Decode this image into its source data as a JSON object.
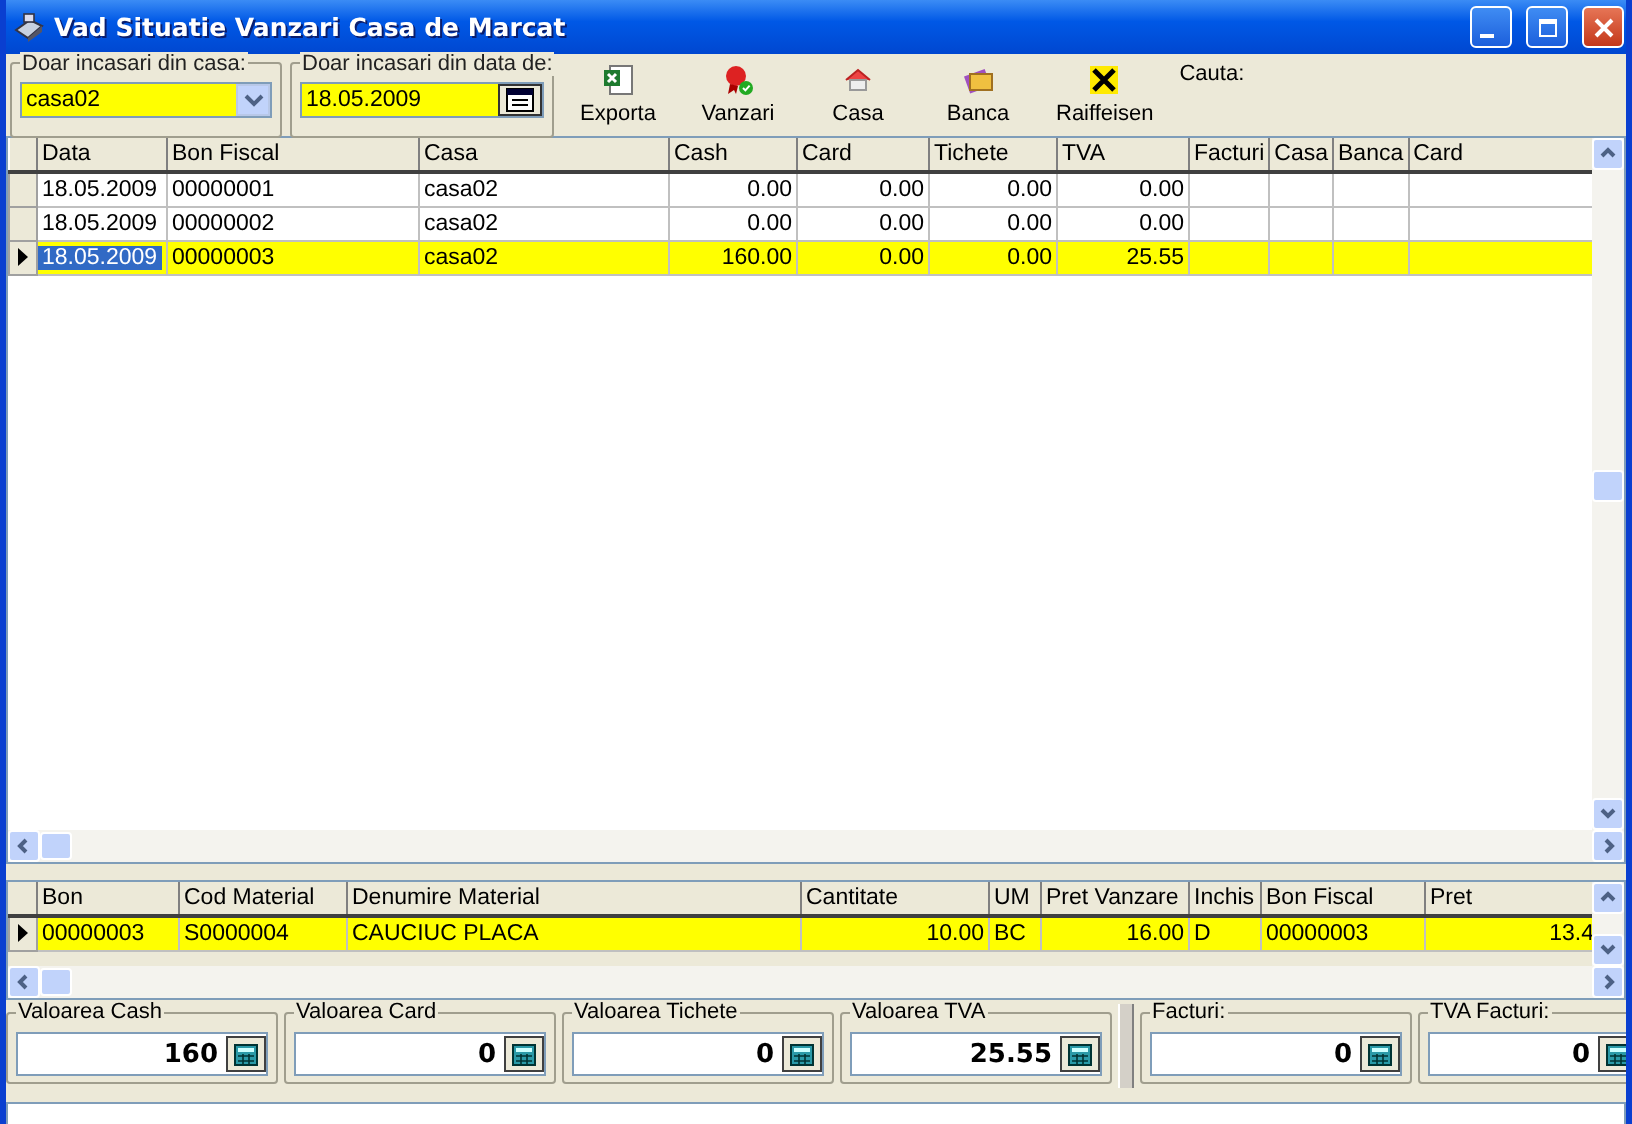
{
  "window": {
    "title": "Vad Situatie Vanzari Casa de Marcat"
  },
  "filters": [
    {
      "kind": "combo",
      "label": "Doar incasari din casa:",
      "value": "casa02"
    },
    {
      "kind": "date",
      "label": "Doar incasari din data de:",
      "value": "18.05.2009"
    }
  ],
  "toolbar": [
    {
      "kind": "spreadsheet",
      "label": "Exporta"
    },
    {
      "kind": "ribbon",
      "label": "Vanzari"
    },
    {
      "kind": "house",
      "label": "Casa"
    },
    {
      "kind": "bank",
      "label": "Banca"
    },
    {
      "kind": "cross",
      "label": "Raiffeisen"
    }
  ],
  "search": {
    "label": "Cauta:"
  },
  "main_table": {
    "columns": [
      {
        "label": "Data",
        "kind": "text"
      },
      {
        "label": "Bon Fiscal",
        "kind": "text"
      },
      {
        "label": "Casa",
        "kind": "text"
      },
      {
        "label": "Cash",
        "kind": "number"
      },
      {
        "label": "Card",
        "kind": "number"
      },
      {
        "label": "Tichete",
        "kind": "number"
      },
      {
        "label": "TVA",
        "kind": "number"
      },
      {
        "label": "Facturi",
        "kind": "text"
      },
      {
        "label": "Casa",
        "kind": "text"
      },
      {
        "label": "Banca",
        "kind": "text"
      },
      {
        "label": "Card",
        "kind": "text"
      }
    ],
    "rows": [
      {
        "selected": false,
        "cells": [
          "18.05.2009",
          "00000001",
          "casa02",
          "0.00",
          "0.00",
          "0.00",
          "0.00",
          "",
          "",
          "",
          ""
        ]
      },
      {
        "selected": false,
        "cells": [
          "18.05.2009",
          "00000002",
          "casa02",
          "0.00",
          "0.00",
          "0.00",
          "0.00",
          "",
          "",
          "",
          ""
        ]
      },
      {
        "selected": true,
        "cells": [
          "18.05.2009",
          "00000003",
          "casa02",
          "160.00",
          "0.00",
          "0.00",
          "25.55",
          "",
          "",
          "",
          ""
        ]
      }
    ]
  },
  "detail_table": {
    "columns": [
      {
        "label": "Bon",
        "kind": "text"
      },
      {
        "label": "Cod Material",
        "kind": "text"
      },
      {
        "label": "Denumire Material",
        "kind": "text"
      },
      {
        "label": "Cantitate",
        "kind": "number"
      },
      {
        "label": "UM",
        "kind": "text"
      },
      {
        "label": "Pret Vanzare",
        "kind": "number"
      },
      {
        "label": "Inchis",
        "kind": "text"
      },
      {
        "label": "Bon Fiscal",
        "kind": "text"
      },
      {
        "label": "Pret",
        "kind": "number"
      }
    ],
    "rows": [
      {
        "selected": true,
        "cells": [
          "00000003",
          "S0000004",
          "CAUCIUC PLACA",
          "10.00",
          "BC",
          "16.00",
          "D",
          "00000003",
          "13.4"
        ]
      }
    ]
  },
  "totals": [
    {
      "label": "Valoarea Cash",
      "value": "160"
    },
    {
      "label": "Valoarea Card",
      "value": "0"
    },
    {
      "label": "Valoarea Tichete",
      "value": "0"
    },
    {
      "label": "Valoarea TVA",
      "value": "25.55"
    }
  ],
  "invoice_totals": [
    {
      "label": "Facturi:",
      "value": "0"
    },
    {
      "label": "TVA Facturi:",
      "value": "0"
    }
  ]
}
